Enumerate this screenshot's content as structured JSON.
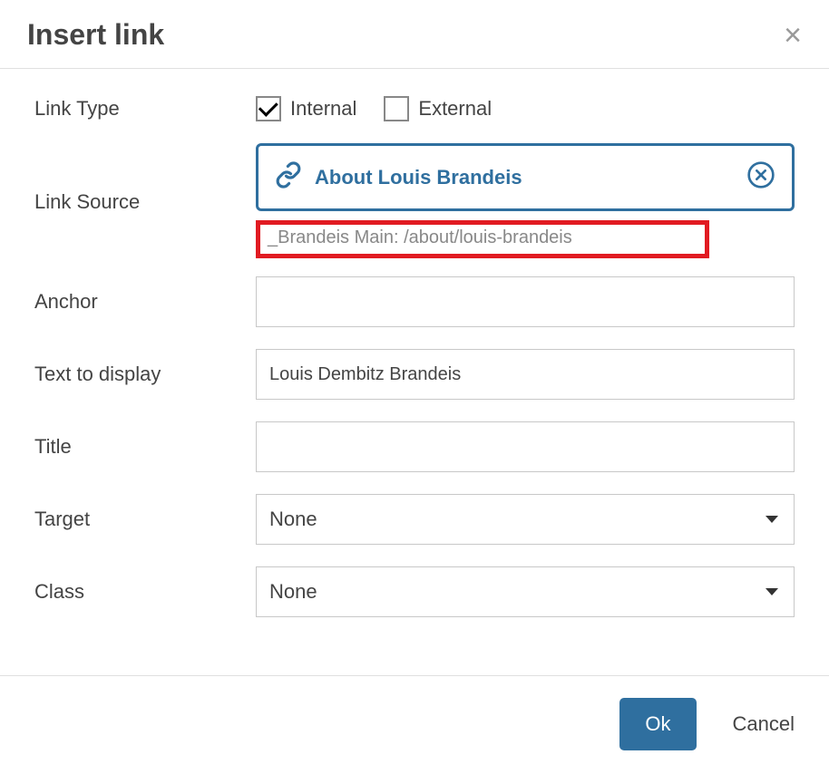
{
  "dialog": {
    "title": "Insert link"
  },
  "fields": {
    "linkType": {
      "label": "Link Type",
      "options": {
        "internal": {
          "label": "Internal",
          "checked": true
        },
        "external": {
          "label": "External",
          "checked": false
        }
      }
    },
    "linkSource": {
      "label": "Link Source",
      "chipText": "About Louis Brandeis",
      "path": "_Brandeis Main: /about/louis-brandeis"
    },
    "anchor": {
      "label": "Anchor",
      "value": ""
    },
    "textToDisplay": {
      "label": "Text to display",
      "value": "Louis Dembitz Brandeis"
    },
    "title": {
      "label": "Title",
      "value": ""
    },
    "target": {
      "label": "Target",
      "selected": "None"
    },
    "klass": {
      "label": "Class",
      "selected": "None"
    }
  },
  "footer": {
    "ok": "Ok",
    "cancel": "Cancel"
  }
}
